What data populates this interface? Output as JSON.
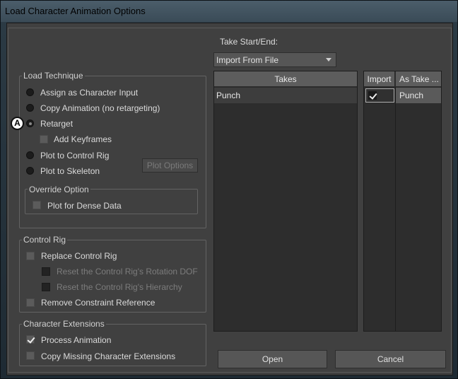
{
  "window": {
    "title": "Load Character Animation Options"
  },
  "take_start_end": {
    "label": "Take Start/End:",
    "value": "Import From File"
  },
  "load_technique": {
    "title": "Load Technique",
    "options": [
      {
        "label": "Assign as Character Input",
        "selected": false
      },
      {
        "label": "Copy Animation (no retargeting)",
        "selected": false
      },
      {
        "label": "Retarget",
        "selected": true
      },
      {
        "label": "Plot to Control Rig",
        "selected": false
      },
      {
        "label": "Plot to Skeleton",
        "selected": false
      }
    ],
    "add_keyframes": {
      "label": "Add Keyframes",
      "checked": false
    },
    "plot_options_label": "Plot Options",
    "override": {
      "title": "Override Option",
      "plot_dense": {
        "label": "Plot for Dense Data",
        "checked": false
      }
    }
  },
  "control_rig": {
    "title": "Control Rig",
    "replace": {
      "label": "Replace Control Rig",
      "checked": false
    },
    "reset_rotation": {
      "label": "Reset the Control Rig's Rotation DOF",
      "checked": false
    },
    "reset_hierarchy": {
      "label": "Reset the Control Rig's Hierarchy",
      "checked": false
    },
    "remove_constraint": {
      "label": "Remove Constraint Reference",
      "checked": false
    }
  },
  "character_extensions": {
    "title": "Character Extensions",
    "process_animation": {
      "label": "Process Animation",
      "checked": true
    },
    "copy_missing": {
      "label": "Copy Missing Character Extensions",
      "checked": false
    }
  },
  "takes_table": {
    "header": "Takes",
    "rows": [
      "Punch"
    ]
  },
  "import_table": {
    "headers": [
      "Import",
      "As Take ..."
    ],
    "rows": [
      {
        "import": true,
        "as_take": "Punch"
      }
    ]
  },
  "buttons": {
    "open": "Open",
    "cancel": "Cancel"
  },
  "annotation": {
    "marker": "A"
  }
}
